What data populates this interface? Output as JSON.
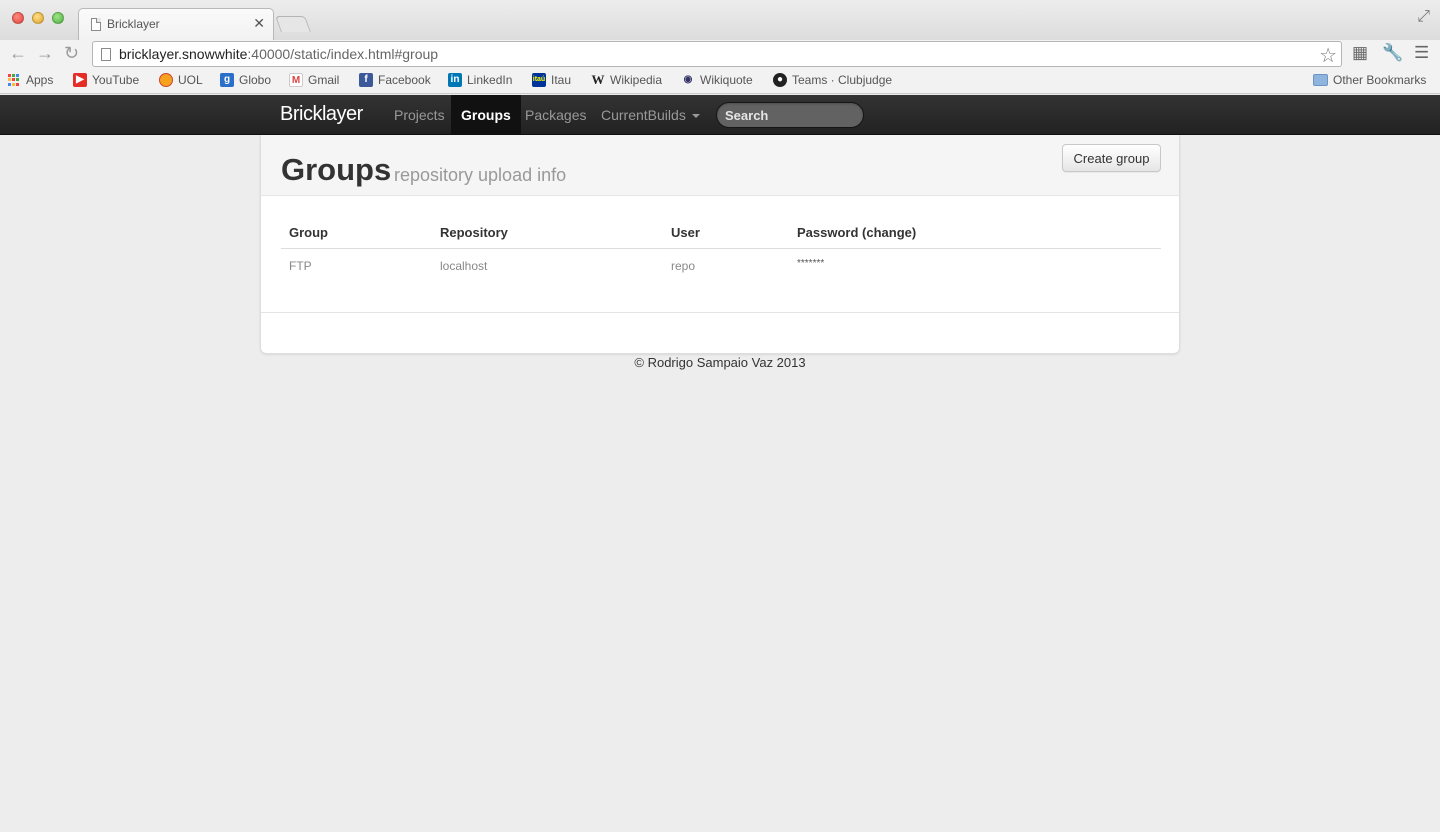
{
  "browser": {
    "tab_title": "Bricklayer",
    "url_host": "bricklayer.snowwhite",
    "url_rest": ":40000/static/index.html#group",
    "bookmarks": [
      "Apps",
      "YouTube",
      "UOL",
      "Globo",
      "Gmail",
      "Facebook",
      "LinkedIn",
      "Itau",
      "Wikipedia",
      "Wikiquote",
      "Teams · Clubjudge"
    ],
    "other_bookmarks": "Other Bookmarks"
  },
  "navbar": {
    "brand": "Bricklayer",
    "items": [
      "Projects",
      "Groups",
      "Packages",
      "CurrentBuilds"
    ],
    "active": "Groups",
    "search_placeholder": "Search"
  },
  "page": {
    "title": "Groups",
    "subtitle": "repository upload info",
    "create_button": "Create group"
  },
  "table": {
    "columns": [
      "Group",
      "Repository",
      "User",
      "Password (change)"
    ],
    "rows": [
      [
        "FTP",
        "localhost",
        "repo",
        "*******"
      ]
    ]
  },
  "footer": {
    "copyright": "© Rodrigo Sampaio Vaz 2013"
  },
  "colors": {
    "navbar_bg": "#222222",
    "page_bg": "#ededed",
    "youtube": "#e52d27",
    "facebook": "#3b5998",
    "linkedin": "#0077b5",
    "globo": "#2a6fc9"
  }
}
